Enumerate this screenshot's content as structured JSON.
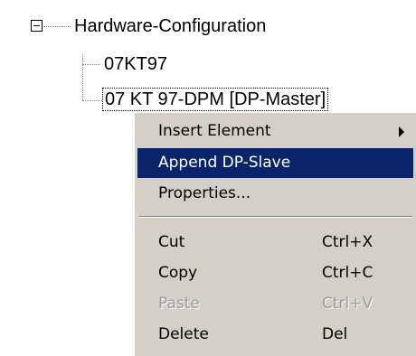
{
  "tree": {
    "root_label": "Hardware-Configuration",
    "child1_label": "07KT97",
    "child2_label": "07 KT 97-DPM [DP-Master]"
  },
  "context_menu": {
    "items": [
      {
        "label": "Insert Element",
        "shortcut": "",
        "has_submenu": true,
        "state": "normal"
      },
      {
        "label": "Append DP-Slave",
        "shortcut": "",
        "state": "highlighted"
      },
      {
        "label": "Properties...",
        "shortcut": "",
        "state": "normal"
      },
      {
        "label": "Cut",
        "shortcut": "Ctrl+X",
        "state": "normal"
      },
      {
        "label": "Copy",
        "shortcut": "Ctrl+C",
        "state": "normal"
      },
      {
        "label": "Paste",
        "shortcut": "Ctrl+V",
        "state": "disabled"
      },
      {
        "label": "Delete",
        "shortcut": "Del",
        "state": "normal"
      }
    ]
  },
  "icons": [
    "collapse-tree-icon",
    "submenu-arrow-icon"
  ],
  "colors": {
    "menu_background": "#d4d0c8",
    "highlight": "#0a246a",
    "disabled_text": "#9a9a9a"
  }
}
